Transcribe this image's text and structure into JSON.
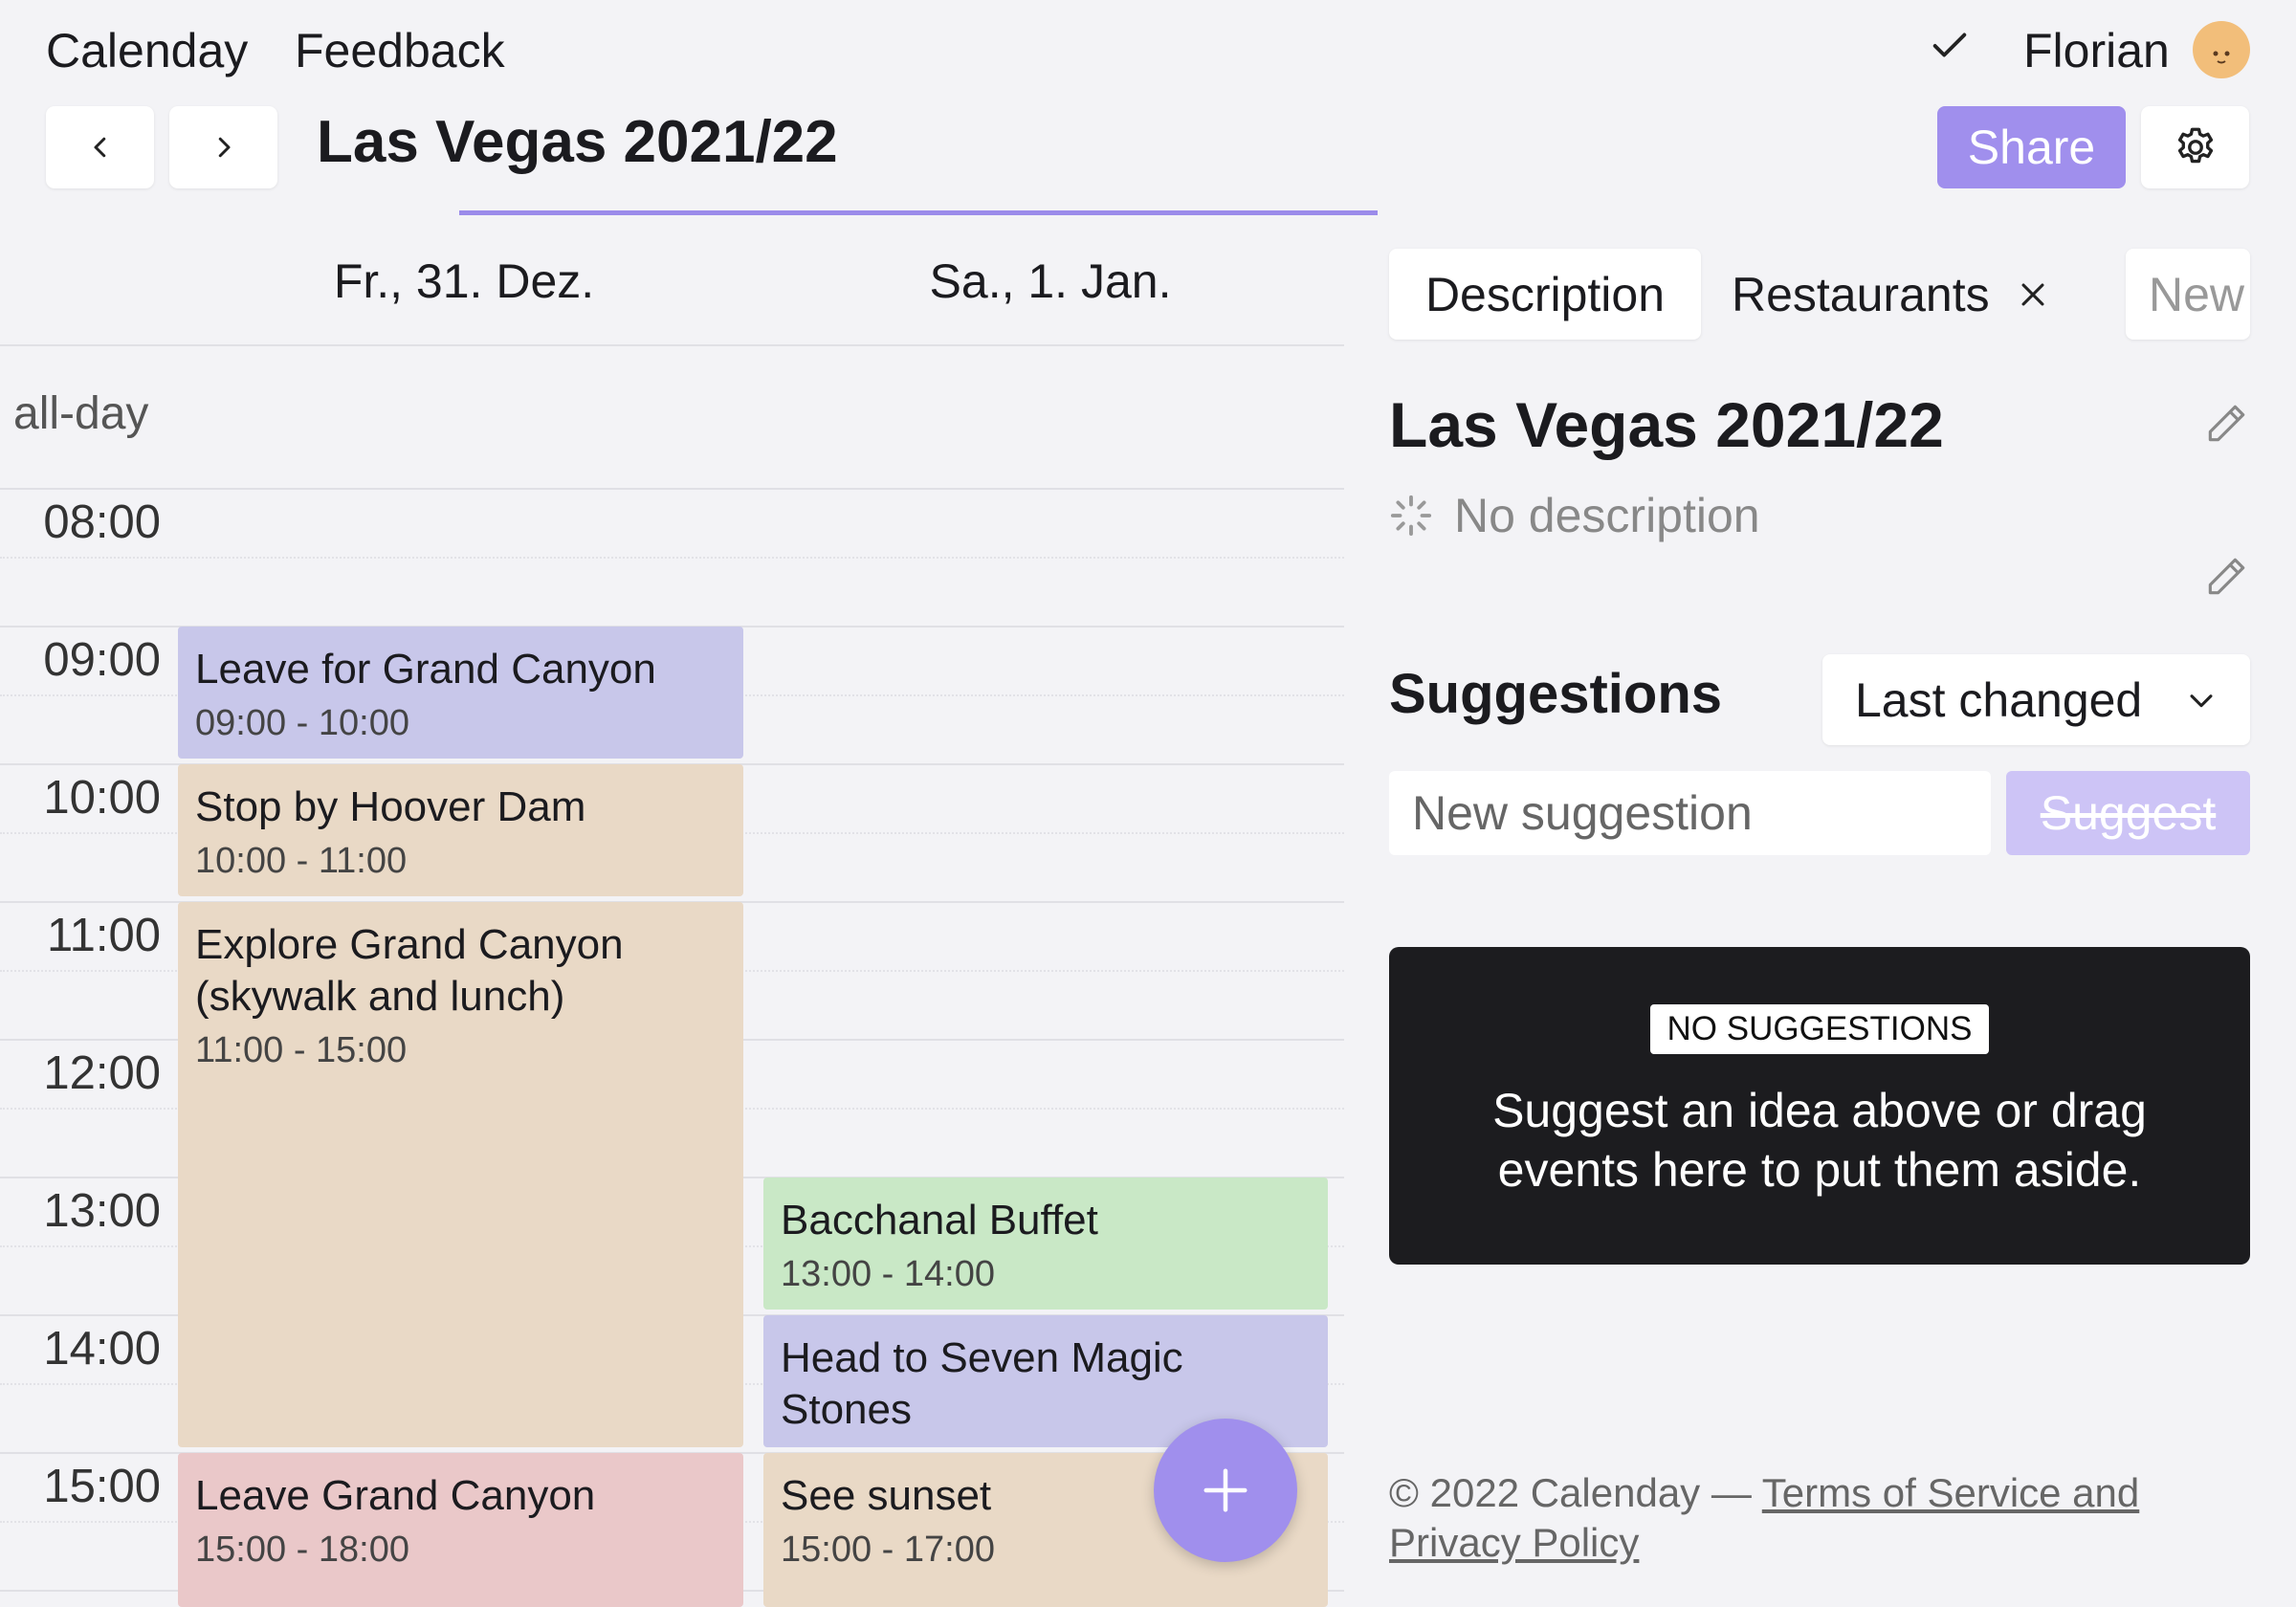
{
  "nav": {
    "brand": "Calenday",
    "feedback": "Feedback"
  },
  "user": {
    "name": "Florian"
  },
  "header": {
    "title": "Las Vegas 2021/22",
    "share_label": "Share"
  },
  "calendar": {
    "days": [
      "Fr., 31. Dez.",
      "Sa., 1. Jan."
    ],
    "all_day_label": "all-day",
    "times": [
      "08:00",
      "09:00",
      "10:00",
      "11:00",
      "12:00",
      "13:00",
      "14:00",
      "15:00"
    ],
    "events": [
      {
        "title": "Leave for Grand Canyon",
        "time": "09:00 - 10:00",
        "color": "#c8c7ea"
      },
      {
        "title": "Stop by Hoover Dam",
        "time": "10:00 - 11:00",
        "color": "#e9d9c6"
      },
      {
        "title": "Explore Grand Canyon (skywalk and lunch)",
        "time": "11:00 - 15:00",
        "color": "#e9d9c6"
      },
      {
        "title": "Leave Grand Canyon",
        "time": "15:00 - 18:00",
        "color": "#eac8c9"
      },
      {
        "title": "Bacchanal Buffet",
        "time": "13:00 - 14:00",
        "color": "#c9e8c6"
      },
      {
        "title": "Head to Seven Magic Stones",
        "time": "",
        "color": "#c8c7ea"
      },
      {
        "title": "See sunset",
        "time": "15:00 - 17:00",
        "color": "#e9d9c6"
      }
    ]
  },
  "panel": {
    "tabs": [
      "Description",
      "Restaurants",
      "New"
    ],
    "title": "Las Vegas 2021/22",
    "no_description": "No description",
    "suggestions_title": "Suggestions",
    "sort_selected": "Last changed",
    "suggestion_placeholder": "New suggestion",
    "suggest_button": "Suggest",
    "empty_badge": "NO SUGGESTIONS",
    "empty_text": "Suggest an idea above or drag events here to put them aside."
  },
  "footer": {
    "copyright": "© 2022 Calenday — ",
    "terms_link": "Terms of Service and Privacy Policy"
  },
  "colors": {
    "accent": "#a08fed",
    "progress": "#9b8bea",
    "dark_box": "#1c1c1f"
  }
}
